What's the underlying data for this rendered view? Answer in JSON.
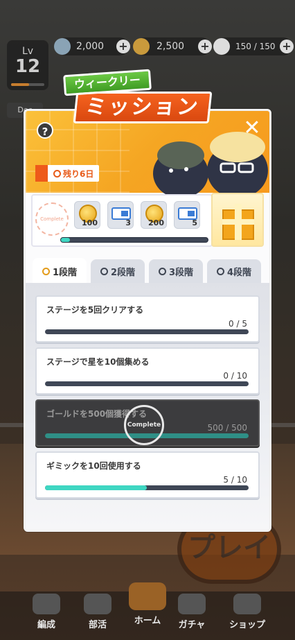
{
  "status": {
    "level_label": "Lv",
    "level": "12",
    "gold": "2,000",
    "coins": "2,500",
    "stamina": "150 / 150"
  },
  "background": {
    "side_button_label": "Dec",
    "play_label": "プレイ"
  },
  "dialog": {
    "title_sub": "ウィークリー",
    "title_main": "ミッション",
    "help_symbol": "?",
    "close_symbol": "✕",
    "remaining": "残り6日",
    "stamp_text": "Complete",
    "rewards": [
      {
        "type": "gold-icon",
        "qty": "100"
      },
      {
        "type": "ticket-icon",
        "qty": "3"
      },
      {
        "type": "gold-icon",
        "qty": "200"
      },
      {
        "type": "ticket-icon",
        "qty": "5"
      }
    ],
    "reward_progress": 0.06,
    "tabs": [
      {
        "label": "1段階",
        "active": true
      },
      {
        "label": "2段階",
        "active": false
      },
      {
        "label": "3段階",
        "active": false
      },
      {
        "label": "4段階",
        "active": false
      }
    ],
    "missions": [
      {
        "title": "ステージを5回クリアする",
        "count": "0 / 5",
        "progress": 0.0,
        "done": false
      },
      {
        "title": "ステージで星を10個集める",
        "count": "0 / 10",
        "progress": 0.0,
        "done": false
      },
      {
        "title": "ゴールドを500個獲得する",
        "count": "500 / 500",
        "progress": 1.0,
        "done": true
      },
      {
        "title": "ギミックを10回使用する",
        "count": "5 / 10",
        "progress": 0.5,
        "done": false
      }
    ],
    "complete_badge": "Complete"
  },
  "nav": [
    {
      "label": "編成"
    },
    {
      "label": "部活"
    },
    {
      "label": "ホーム"
    },
    {
      "label": "ガチャ"
    },
    {
      "label": "ショップ"
    }
  ],
  "colors": {
    "accent_orange": "#f5a623",
    "progress_teal": "#3fd6c2",
    "title_red": "#e8521a",
    "title_green": "#4fae2c"
  }
}
